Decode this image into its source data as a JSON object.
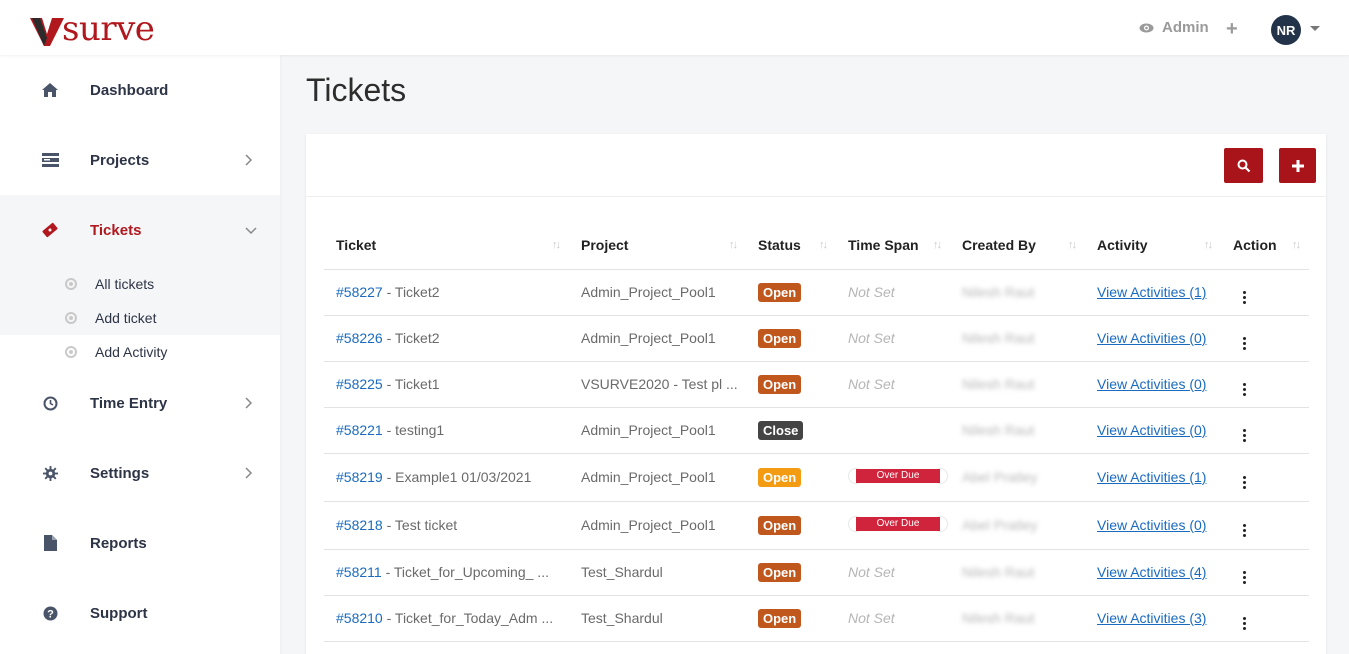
{
  "brand": {
    "logo_text": "surve",
    "accent": "#b0181e"
  },
  "topbar": {
    "view_label": "Admin",
    "add_icon": "plus-icon",
    "avatar_initials": "NR"
  },
  "sidebar": {
    "items": [
      {
        "label": "Dashboard",
        "icon": "home-icon"
      },
      {
        "label": "Projects",
        "icon": "server-icon"
      },
      {
        "label": "Tickets",
        "icon": "ticket-icon"
      },
      {
        "label": "Time Entry",
        "icon": "clock-icon"
      },
      {
        "label": "Settings",
        "icon": "gear-icon"
      },
      {
        "label": "Reports",
        "icon": "file-icon"
      },
      {
        "label": "Support",
        "icon": "question-icon"
      }
    ],
    "ticket_submenu": [
      "All tickets",
      "Add ticket",
      "Add Activity"
    ]
  },
  "page": {
    "title": "Tickets"
  },
  "table": {
    "headers": [
      "Ticket",
      "Project",
      "Status",
      "Time Span",
      "Created By",
      "Activity",
      "Action"
    ],
    "rows": [
      {
        "id": "#58227",
        "name": " - Ticket2",
        "project": "Admin_Project_Pool1",
        "status": "Open",
        "status_color": "#c0581e",
        "time_span": "Not Set",
        "created_by": "Nilesh Raut",
        "activity": "View Activities (1)"
      },
      {
        "id": "#58226",
        "name": " - Ticket2",
        "project": "Admin_Project_Pool1",
        "status": "Open",
        "status_color": "#c0581e",
        "time_span": "Not Set",
        "created_by": "Nilesh Raut",
        "activity": "View Activities (0)"
      },
      {
        "id": "#58225",
        "name": " - Ticket1",
        "project": "VSURVE2020 - Test pl ...",
        "status": "Open",
        "status_color": "#c0581e",
        "time_span": "Not Set",
        "created_by": "Nilesh Raut",
        "activity": "View Activities (0)"
      },
      {
        "id": "#58221",
        "name": " - testing1",
        "project": "Admin_Project_Pool1",
        "status": "Close",
        "status_color": "#444444",
        "time_span": "",
        "created_by": "Nilesh Raut",
        "activity": "View Activities (0)"
      },
      {
        "id": "#58219",
        "name": " - Example1 01/03/2021",
        "project": "Admin_Project_Pool1",
        "status": "Open",
        "status_color": "#f39c12",
        "time_span": "Over Due",
        "created_by": "Abel Pratley",
        "activity": "View Activities (1)"
      },
      {
        "id": "#58218",
        "name": " - Test ticket",
        "project": "Admin_Project_Pool1",
        "status": "Open",
        "status_color": "#c0581e",
        "time_span": "Over Due",
        "created_by": "Abel Pratley",
        "activity": "View Activities (0)"
      },
      {
        "id": "#58211",
        "name": " - Ticket_for_Upcoming_ ...",
        "project": "Test_Shardul",
        "status": "Open",
        "status_color": "#c0581e",
        "time_span": "Not Set",
        "created_by": "Nilesh Raut",
        "activity": "View Activities (4)"
      },
      {
        "id": "#58210",
        "name": " - Ticket_for_Today_Adm ...",
        "project": "Test_Shardul",
        "status": "Open",
        "status_color": "#c0581e",
        "time_span": "Not Set",
        "created_by": "Nilesh Raut",
        "activity": "View Activities (3)"
      }
    ]
  }
}
